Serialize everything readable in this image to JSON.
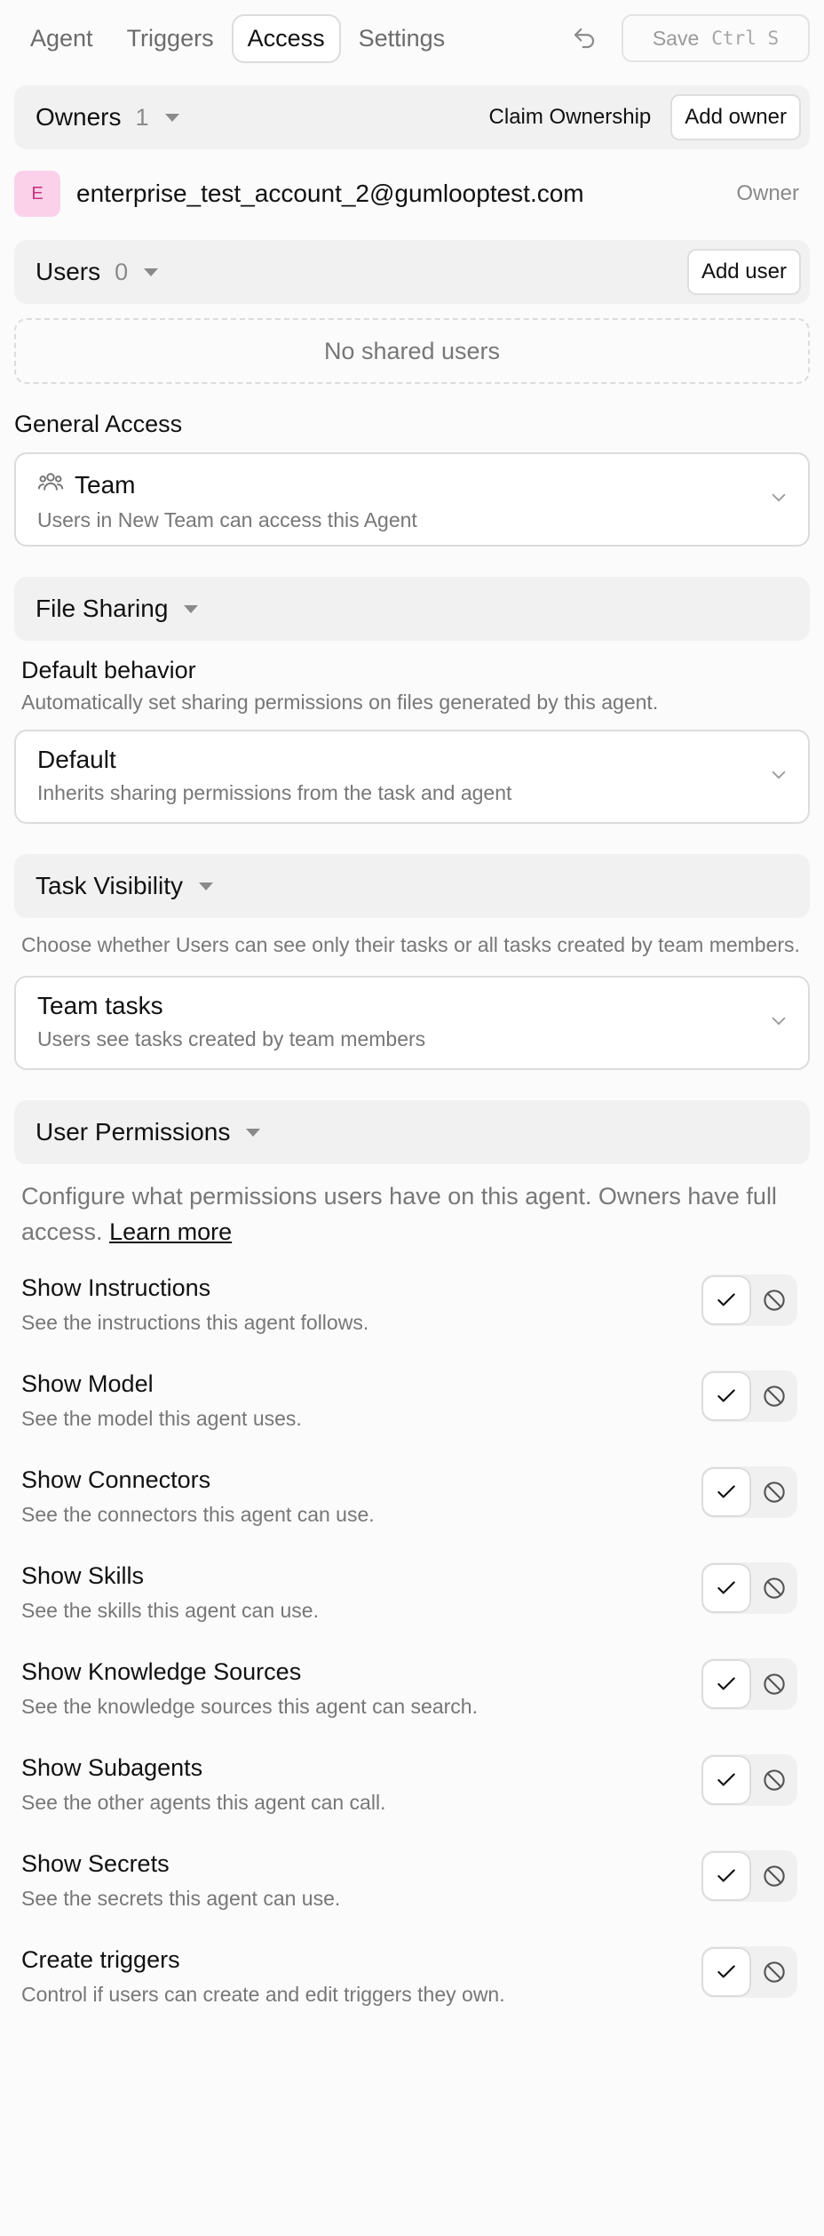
{
  "tabs": [
    {
      "label": "Agent"
    },
    {
      "label": "Triggers"
    },
    {
      "label": "Access"
    },
    {
      "label": "Settings"
    }
  ],
  "toolbar": {
    "save_label": "Save",
    "save_shortcut": "Ctrl S"
  },
  "owners": {
    "title": "Owners",
    "count": "1",
    "claim_label": "Claim Ownership",
    "add_label": "Add owner",
    "items": [
      {
        "avatar": "E",
        "email": "enterprise_test_account_2@gumlooptest.com",
        "role": "Owner"
      }
    ]
  },
  "users": {
    "title": "Users",
    "count": "0",
    "add_label": "Add user",
    "empty_text": "No shared users"
  },
  "general_access": {
    "title": "General Access",
    "value": "Team",
    "description": "Users in New Team can access this Agent"
  },
  "file_sharing": {
    "title": "File Sharing",
    "default_title": "Default behavior",
    "default_desc": "Automatically set sharing permissions on files generated by this agent.",
    "value": "Default",
    "value_desc": "Inherits sharing permissions from the task and agent"
  },
  "task_visibility": {
    "title": "Task Visibility",
    "desc": "Choose whether Users can see only their tasks or all tasks created by team members.",
    "value": "Team tasks",
    "value_desc": "Users see tasks created by team members"
  },
  "user_permissions": {
    "title": "User Permissions",
    "desc": "Configure what permissions users have on this agent. Owners have full access.",
    "learn_more": "Learn more",
    "items": [
      {
        "title": "Show Instructions",
        "desc": "See the instructions this agent follows."
      },
      {
        "title": "Show Model",
        "desc": "See the model this agent uses."
      },
      {
        "title": "Show Connectors",
        "desc": "See the connectors this agent can use."
      },
      {
        "title": "Show Skills",
        "desc": "See the skills this agent can use."
      },
      {
        "title": "Show Knowledge Sources",
        "desc": "See the knowledge sources this agent can search."
      },
      {
        "title": "Show Subagents",
        "desc": "See the other agents this agent can call."
      },
      {
        "title": "Show Secrets",
        "desc": "See the secrets this agent can use."
      },
      {
        "title": "Create triggers",
        "desc": "Control if users can create and edit triggers they own."
      }
    ]
  }
}
